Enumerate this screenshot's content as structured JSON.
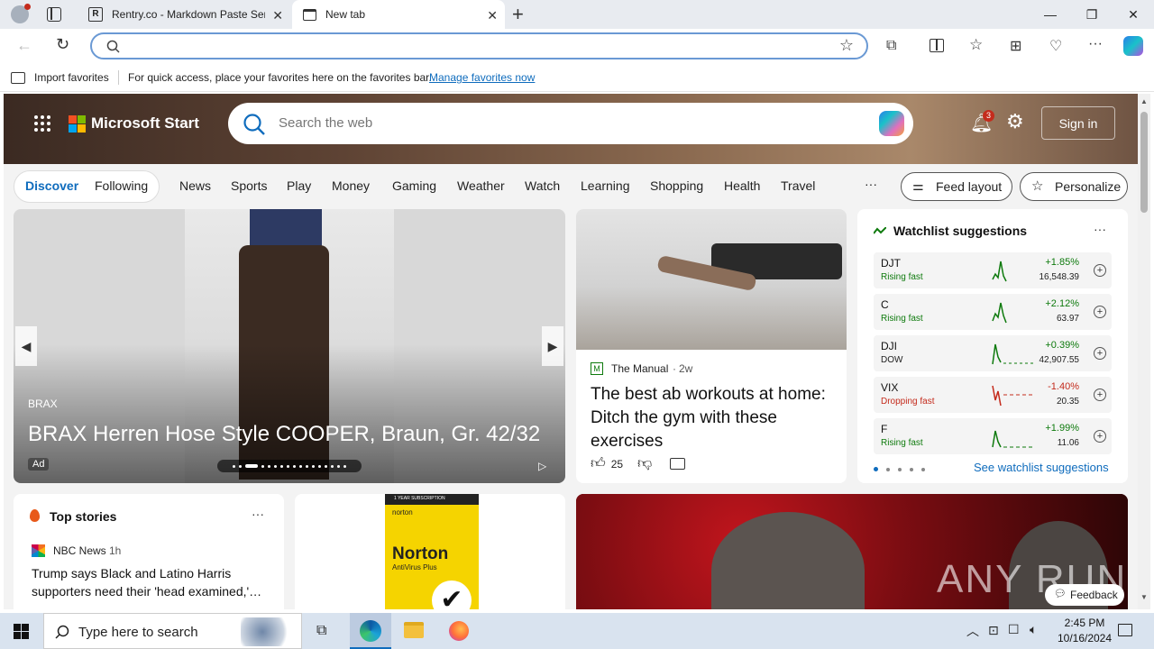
{
  "browser": {
    "tabs": [
      {
        "title": "Rentry.co - Markdown Paste Serv"
      },
      {
        "title": "New tab"
      }
    ],
    "favorites_bar": {
      "import_label": "Import favorites",
      "message": "For quick access, place your favorites here on the favorites bar.",
      "manage_link": "Manage favorites now"
    }
  },
  "msn": {
    "brand": "Microsoft Start",
    "search_placeholder": "Search the web",
    "notification_count": "3",
    "sign_in": "Sign in",
    "feed_tabs": [
      "Discover",
      "Following"
    ],
    "nav": [
      "News",
      "Sports",
      "Play",
      "Money",
      "Gaming",
      "Weather",
      "Watch",
      "Learning",
      "Shopping",
      "Health",
      "Travel"
    ],
    "more": "···",
    "feed_layout": "Feed layout",
    "personalize": "Personalize",
    "hero_ad": {
      "brand": "BRAX",
      "title": "BRAX Herren Hose Style COOPER, Braun, Gr. 42/32",
      "ad_label": "Ad"
    },
    "article": {
      "source": "The Manual",
      "age": "2w",
      "title": "The best ab workouts at home: Ditch the gym with these exercises",
      "likes": "25"
    },
    "watchlist": {
      "title": "Watchlist suggestions",
      "see_all": "See watchlist suggestions",
      "rows": [
        {
          "symbol": "DJT",
          "status": "Rising fast",
          "change": "+1.85%",
          "value": "16,548.39",
          "dir": "up"
        },
        {
          "symbol": "C",
          "status": "Rising fast",
          "change": "+2.12%",
          "value": "63.97",
          "dir": "up"
        },
        {
          "symbol": "DJI",
          "status": "DOW",
          "change": "+0.39%",
          "value": "42,907.55",
          "dir": "up"
        },
        {
          "symbol": "VIX",
          "status": "Dropping fast",
          "change": "-1.40%",
          "value": "20.35",
          "dir": "down"
        },
        {
          "symbol": "F",
          "status": "Rising fast",
          "change": "+1.99%",
          "value": "11.06",
          "dir": "up"
        }
      ]
    },
    "top_stories": {
      "title": "Top stories",
      "source": "NBC News",
      "age": "1h",
      "headline": "Trump says Black and Latino Harris supporters need their 'head examined,'…"
    },
    "norton": {
      "line1": "1 YEAR SUBSCRIPTION",
      "brand": "norton",
      "product": "Norton",
      "sub": "AntiVirus Plus"
    },
    "watermark": "ANY RUN",
    "feedback": "Feedback"
  },
  "taskbar": {
    "search_placeholder": "Type here to search",
    "time": "2:45 PM",
    "date": "10/16/2024"
  },
  "colors": {
    "accent": "#0f6cbd",
    "up": "#0e7a0d",
    "down": "#c42b1c"
  }
}
